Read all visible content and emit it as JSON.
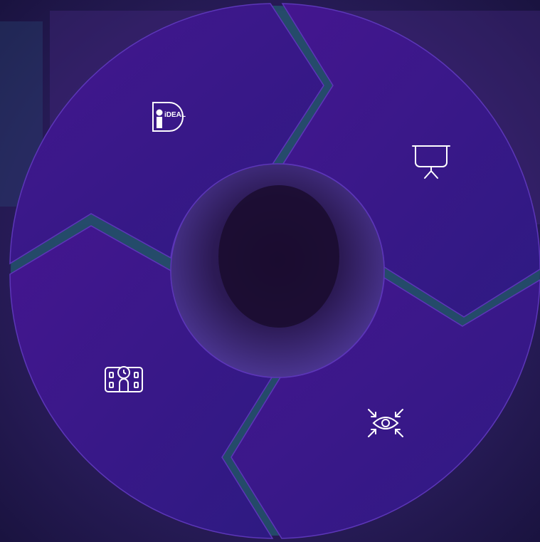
{
  "colors": {
    "segment": "#3b1a8a",
    "segment_edge": "#5c36b8",
    "gap": "#2a5a70",
    "icon": "#ffffff",
    "background": "#231a4a",
    "center": "#2a1850"
  },
  "segments": [
    {
      "name": "ideal",
      "icon": "ideal-logo-icon"
    },
    {
      "name": "presentation",
      "icon": "presentation-board-icon"
    },
    {
      "name": "focus",
      "icon": "focus-eye-icon"
    },
    {
      "name": "school",
      "icon": "school-building-icon"
    }
  ],
  "center": {
    "icon": "person-photo"
  },
  "logo_text": "iDEAL"
}
